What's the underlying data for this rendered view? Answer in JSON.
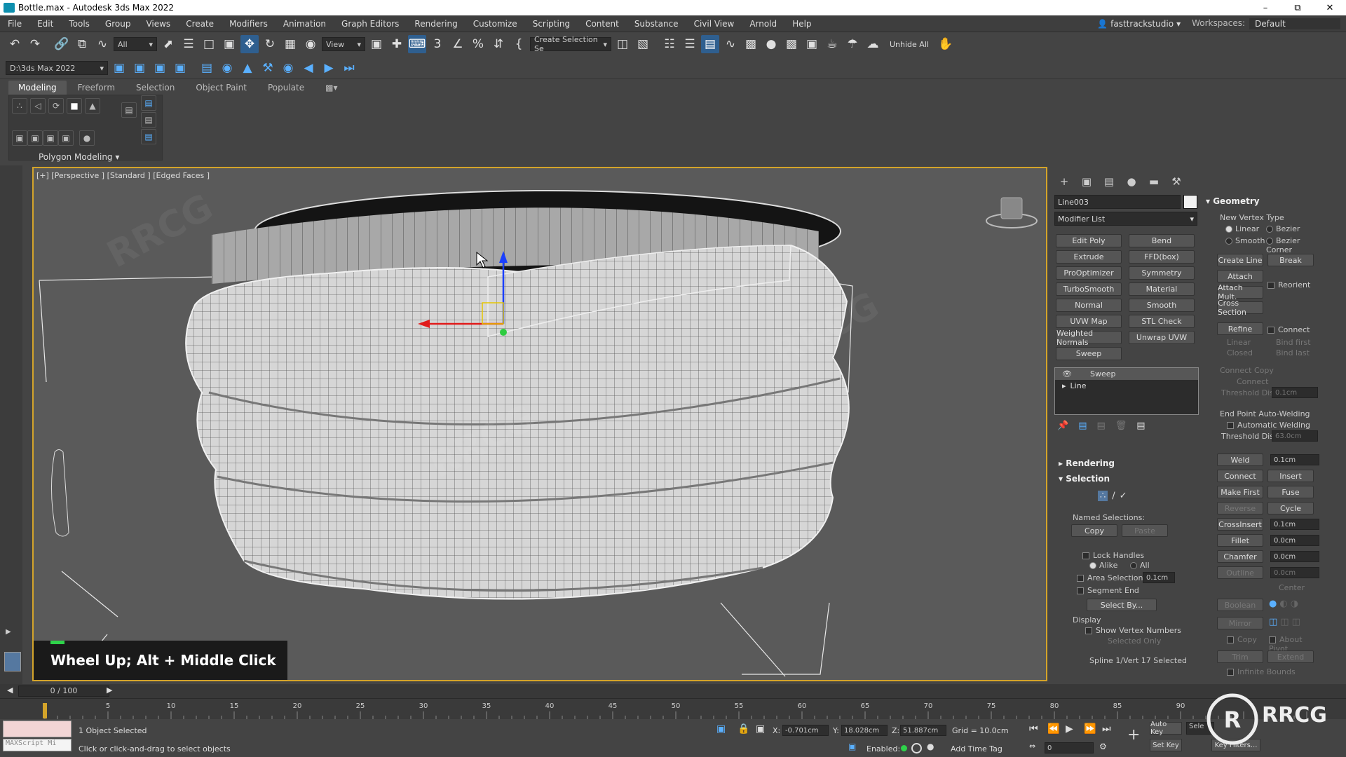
{
  "title": "Bottle.max - Autodesk 3ds Max 2022",
  "menu": [
    "File",
    "Edit",
    "Tools",
    "Group",
    "Views",
    "Create",
    "Modifiers",
    "Animation",
    "Graph Editors",
    "Rendering",
    "Customize",
    "Scripting",
    "Content",
    "Substance",
    "Civil View",
    "Arnold",
    "Help"
  ],
  "account": "fasttrackstudio",
  "workspace_label": "Workspaces:",
  "workspace_value": "Default",
  "toolbar": {
    "filter_value": "All",
    "view_value": "View",
    "create_selection_set": "Create Selection Se",
    "unhide_all": "Unhide All",
    "project_path": "D:\\3ds Max 2022"
  },
  "ribbon": {
    "tabs": [
      "Modeling",
      "Freeform",
      "Selection",
      "Object Paint",
      "Populate"
    ],
    "panel_label": "Polygon Modeling"
  },
  "viewport": {
    "label": "[+] [Perspective ] [Standard ] [Edged Faces ]",
    "hint": "Wheel Up; Alt + Middle Click"
  },
  "command_panel": {
    "object_name": "Line003",
    "modifier_list": "Modifier List",
    "modifier_buttons": [
      [
        "Edit Poly",
        "Bend"
      ],
      [
        "Extrude",
        "FFD(box)"
      ],
      [
        "ProOptimizer",
        "Symmetry"
      ],
      [
        "TurboSmooth",
        "Material"
      ],
      [
        "Normal",
        "Smooth"
      ],
      [
        "UVW Map",
        "STL Check"
      ],
      [
        "Weighted Normals",
        "Unwrap UVW"
      ],
      [
        "Sweep",
        ""
      ]
    ],
    "stack": [
      "Sweep",
      "Line"
    ],
    "rendering": "Rendering",
    "selection": "Selection",
    "named_selections": "Named Selections:",
    "copy": "Copy",
    "paste": "Paste",
    "lock_handles": "Lock Handles",
    "alike": "Alike",
    "all": "All",
    "area_selection": "Area Selection",
    "area_value": "0.1cm",
    "segment_end": "Segment End",
    "select_by": "Select By...",
    "display": "Display",
    "show_vertex_numbers": "Show Vertex Numbers",
    "selected_only": "Selected Only",
    "status": "Spline 1/Vert 17 Selected"
  },
  "geometry": {
    "header": "Geometry",
    "new_vertex_type": "New Vertex Type",
    "types": [
      "Linear",
      "Bezier",
      "Smooth",
      "Bezier Corner"
    ],
    "create_line": "Create Line",
    "break": "Break",
    "attach": "Attach",
    "reorient": "Reorient",
    "attach_mult": "Attach Mult.",
    "cross_section": "Cross Section",
    "refine": "Refine",
    "connect": "Connect",
    "linear": "Linear",
    "bind_first": "Bind first",
    "closed": "Closed",
    "bind_last": "Bind last",
    "connect_copy": "Connect Copy",
    "connect2": "Connect",
    "threshold_dist": "Threshold Dist",
    "threshold_value": "0.1cm",
    "endpoint_autowelding": "End Point Auto-Welding",
    "automatic_welding": "Automatic Welding",
    "threshold_dist2": "Threshold Dist",
    "threshold_value2": "63.0cm",
    "weld": "Weld",
    "weld_value": "0.1cm",
    "connect3": "Connect",
    "insert": "Insert",
    "make_first": "Make First",
    "fuse": "Fuse",
    "reverse": "Reverse",
    "cycle": "Cycle",
    "crossinsert": "CrossInsert",
    "crossinsert_value": "0.1cm",
    "fillet": "Fillet",
    "fillet_value": "0.0cm",
    "chamfer": "Chamfer",
    "chamfer_value": "0.0cm",
    "outline": "Outline",
    "outline_value": "0.0cm",
    "center": "Center",
    "boolean": "Boolean",
    "mirror": "Mirror",
    "copy": "Copy",
    "about_pivot": "About Pivot",
    "trim": "Trim",
    "extend": "Extend",
    "infinite_bounds": "Infinite Bounds"
  },
  "timeline": {
    "frame": "0 / 100",
    "ticks": [
      5,
      10,
      15,
      20,
      25,
      30,
      35,
      40,
      45,
      50,
      55,
      60,
      65,
      70,
      75,
      80,
      85,
      90
    ]
  },
  "status": {
    "selected": "1 Object Selected",
    "prompt": "Click or click-and-drag to select objects",
    "maxscript": "MAXScript Mi",
    "x_label": "X:",
    "x": "-0.701cm",
    "y_label": "Y:",
    "y": "18.028cm",
    "z_label": "Z:",
    "z": "51.887cm",
    "grid": "Grid = 10.0cm",
    "enabled": "Enabled:",
    "add_time_tag": "Add Time Tag",
    "auto_key": "Auto Key",
    "set_key": "Set Key",
    "selected_short": "Sele",
    "key_filters": "Key Filters...",
    "frame_field": "0"
  },
  "watermark": "RRCG"
}
